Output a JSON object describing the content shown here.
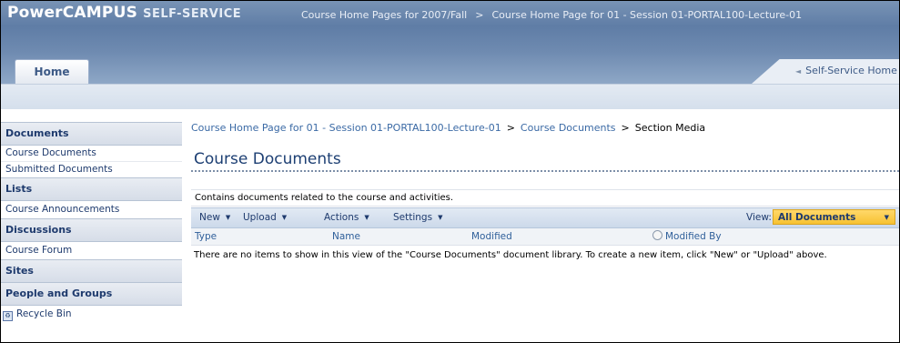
{
  "header": {
    "brand_main": "PowerCAMPUS",
    "brand_small": "SELF-SERVICE",
    "crumb_1": "Course Home Pages for 2007/Fall",
    "crumb_sep": ">",
    "crumb_2": "Course Home Page for 01 - Session 01-PORTAL100-Lecture-01",
    "home_tab": "Home",
    "self_service_tab": "Self-Service Home"
  },
  "sidebar": {
    "documents_heading": "Documents",
    "documents_items": [
      "Course Documents",
      "Submitted Documents"
    ],
    "lists_heading": "Lists",
    "lists_items": [
      "Course Announcements"
    ],
    "discussions_heading": "Discussions",
    "discussions_items": [
      "Course Forum"
    ],
    "sites_heading": "Sites",
    "people_heading": "People and Groups",
    "recycle_bin": "Recycle Bin"
  },
  "main": {
    "breadcrumb": {
      "link_1": "Course Home Page for 01 - Session 01-PORTAL100-Lecture-01",
      "link_2": "Course Documents",
      "current": "Section Media",
      "sep": ">"
    },
    "title": "Course Documents",
    "description": "Contains documents related to the course and activities.",
    "toolbar": {
      "new": "New",
      "upload": "Upload",
      "actions": "Actions",
      "settings": "Settings",
      "view_label": "View:",
      "view_value": "All Documents"
    },
    "columns": [
      "Type",
      "Name",
      "Modified",
      "Modified By"
    ],
    "empty_message": "There are no items to show in this view of the \"Course Documents\" document library. To create a new item, click \"New\" or \"Upload\" above."
  }
}
